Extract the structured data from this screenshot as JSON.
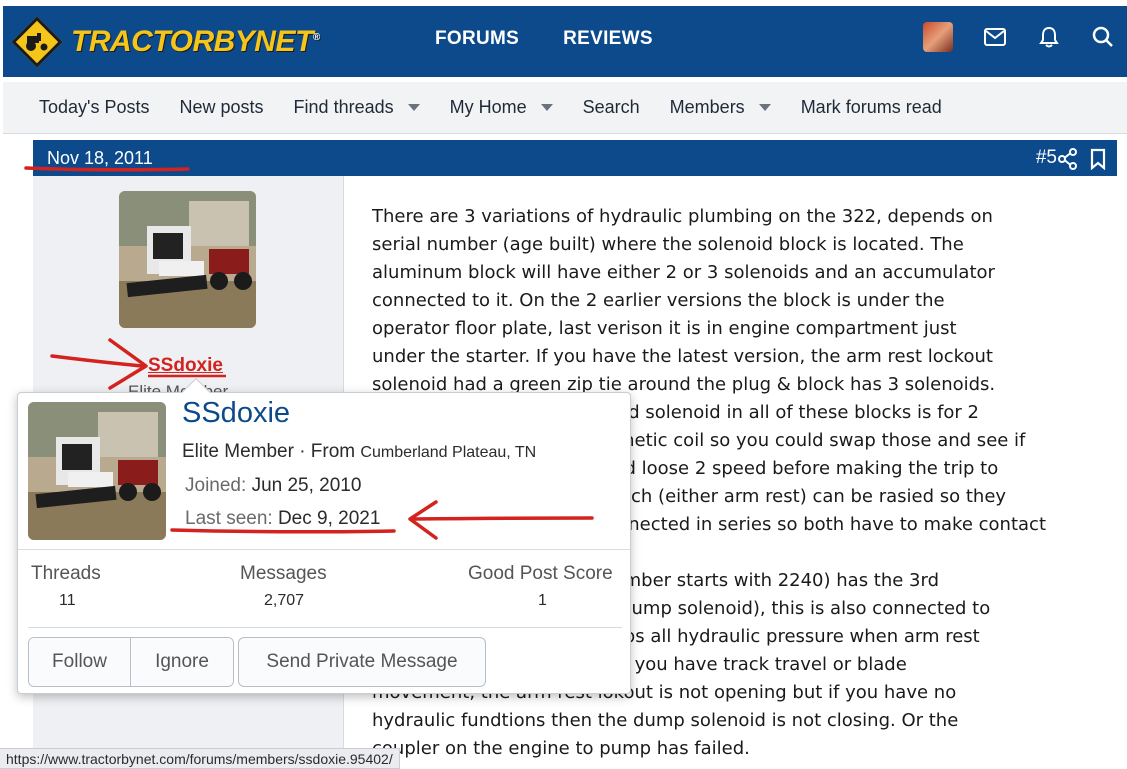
{
  "header": {
    "logo_text": "TRACTORBYNET",
    "logo_mark": "®",
    "nav": [
      "FORUMS",
      "REVIEWS"
    ],
    "icons": [
      "user-avatar",
      "mail-icon",
      "bell-icon",
      "search-icon"
    ]
  },
  "subnav": {
    "items": [
      {
        "label": "Today's Posts",
        "dropdown": false
      },
      {
        "label": "New posts",
        "dropdown": false
      },
      {
        "label": "Find threads",
        "dropdown": true
      },
      {
        "label": "My Home",
        "dropdown": true
      },
      {
        "label": "Search",
        "dropdown": false
      },
      {
        "label": "Members",
        "dropdown": true
      },
      {
        "label": "Mark forums read",
        "dropdown": false
      }
    ]
  },
  "post": {
    "date": "Nov 18, 2011",
    "number": "#5",
    "username": "SSdoxie",
    "usertitle_partial": "Elite Member",
    "body": "There are 3 variations of hydraulic plumbing on the 322, depends on\nserial number (age built) where the solenoid block is located. The\naluminum block will have either 2 or 3 solenoids and an accumulator\nconnected to it. On the 2 earlier versions the block is under the\noperator floor plate, last verison it is in engine compartment just\nunder the starter. If you have the latest version, the arm rest lockout\nsolenoid had a green zip tie around the plug & block has 3 solenoids.\nOn all three versions, the 2nd solenoid in all of these blocks is for 2\nspeed, it has the same magnetic coil so you could swap those and see if\nthe problem moves. If so and loose 2 speed before making the trip to\nthe dealer. The arm rest switch (either arm rest) can be rasied so they\nare not closed. They are connected in series so both have to make contact\nto close the circuit.\nThe latest version (serial number starts with 2240) has the 3rd\nsolenoid (normally opened Dump solenoid), this is also connected to\nthe lockout circuit, this dumps all hydraulic pressure when arm rest\nis up or the circuit is open, if you have track travel or blade\nmovement, the arm rest lokout is not opening but if you have no\nhydraulic fundtions then the dump solenoid is not closing. Or the\ncoupler on the engine to pump has failed."
  },
  "member_card": {
    "name": "SSdoxie",
    "title": "Elite Member",
    "from_label": "· From",
    "location": "Cumberland Plateau, TN",
    "joined_label": "Joined:",
    "joined": "Jun 25, 2010",
    "last_seen_label": "Last seen:",
    "last_seen": "Dec 9, 2021",
    "stats": [
      {
        "label": "Threads",
        "value": "11"
      },
      {
        "label": "Messages",
        "value": "2,707"
      },
      {
        "label": "Good Post Score",
        "value": "1"
      }
    ],
    "buttons": {
      "follow": "Follow",
      "ignore": "Ignore",
      "pm": "Send Private Message"
    }
  },
  "statusbar": {
    "url": "https://www.tractorbynet.com/forums/members/ssdoxie.95402/"
  },
  "colors": {
    "brand_blue": "#0c4a8c",
    "logo_yellow": "#f6c51a",
    "annotation_red": "#d4221e"
  }
}
